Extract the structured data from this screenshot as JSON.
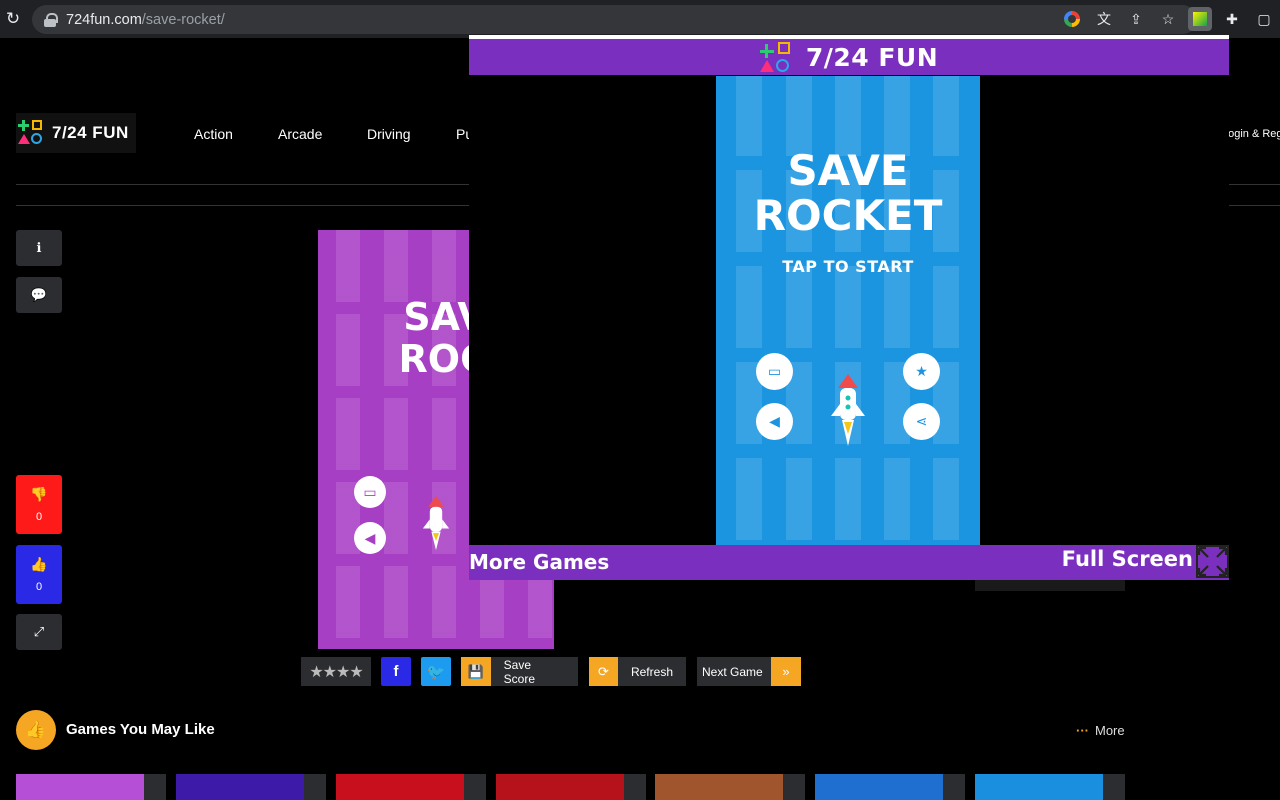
{
  "browser": {
    "url_domain": "724fun.com",
    "url_path": "/save-rocket/"
  },
  "site": {
    "logo_text": "7/24 FUN",
    "nav": [
      "Action",
      "Arcade",
      "Driving",
      "Pu"
    ],
    "login_label": "Login & Register"
  },
  "sidebar": {
    "dislike_count": "0",
    "like_count": "0"
  },
  "background_game": {
    "title_line1": "SAVE",
    "title_line2": "ROCK"
  },
  "overlay": {
    "header_text": "7/24 FUN",
    "more_games": "More Games",
    "full_screen": "Full Screen",
    "game": {
      "title_line1": "SAVE",
      "title_line2": "ROCKET",
      "tap_to_start": "TAP TO START"
    }
  },
  "toolbar": {
    "save_score": "Save Score",
    "refresh": "Refresh",
    "next_game": "Next Game",
    "facebook_glyph": "f",
    "next_glyph": "»"
  },
  "games_you_may_like": {
    "title": "Games You May Like",
    "more": "More",
    "thumbnail_colors": [
      "#b54fd6",
      "#3d1aa8",
      "#c80f1e",
      "#b5121b",
      "#a0552c",
      "#1e6fd0",
      "#1a8fe0"
    ]
  },
  "colors": {
    "overlay_purple": "#7b2fbe",
    "game_blue": "#1b95e0",
    "bg_game_purple": "#a63fc3",
    "accent_orange": "#f5a623",
    "dislike_red": "#ff1a1a",
    "like_blue": "#2929e6",
    "twitter_blue": "#1d9bf0",
    "facebook_blue": "#2929e6"
  }
}
